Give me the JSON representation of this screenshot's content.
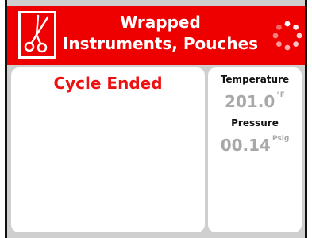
{
  "header": {
    "title_line1": "Wrapped",
    "title_line2": "Instruments, Pouches",
    "cycle_icon": "scissors-icon",
    "activity_icon": "spinner-icon",
    "background_color": "#ee0000"
  },
  "status": {
    "text": "Cycle Ended",
    "color": "#ee1111"
  },
  "readings": {
    "temperature": {
      "label": "Temperature",
      "value": "201.0",
      "unit": "°F"
    },
    "pressure": {
      "label": "Pressure",
      "value": "00.14",
      "unit": "Psig"
    }
  }
}
